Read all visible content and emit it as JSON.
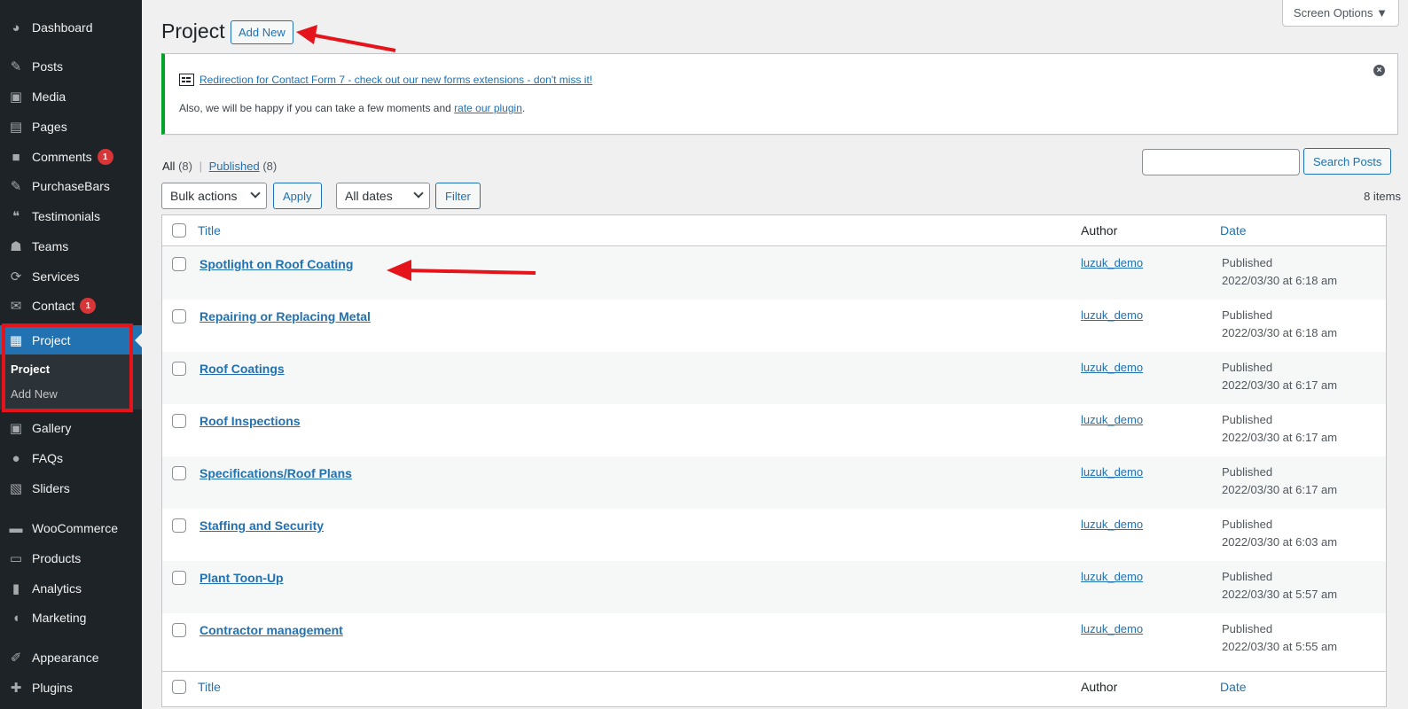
{
  "sidebar": {
    "items": [
      {
        "label": "Dashboard",
        "icon": "dashboard-icon",
        "glyph": "◕"
      },
      {
        "label": "Posts",
        "icon": "pin-icon",
        "glyph": "✎"
      },
      {
        "label": "Media",
        "icon": "media-icon",
        "glyph": "▣"
      },
      {
        "label": "Pages",
        "icon": "pages-icon",
        "glyph": "▤"
      },
      {
        "label": "Comments",
        "icon": "comment-icon",
        "glyph": "■",
        "badge": "1"
      },
      {
        "label": "PurchaseBars",
        "icon": "pin-icon",
        "glyph": "✎"
      },
      {
        "label": "Testimonials",
        "icon": "testimonial-icon",
        "glyph": "❝"
      },
      {
        "label": "Teams",
        "icon": "groups-icon",
        "glyph": "☗"
      },
      {
        "label": "Services",
        "icon": "services-icon",
        "glyph": "⟳"
      },
      {
        "label": "Contact",
        "icon": "mail-icon",
        "glyph": "✉",
        "badge": "1"
      },
      {
        "label": "Project",
        "icon": "portfolio-icon",
        "glyph": "▦"
      },
      {
        "label": "Gallery",
        "icon": "gallery-icon",
        "glyph": "▣"
      },
      {
        "label": "FAQs",
        "icon": "faq-icon",
        "glyph": "●"
      },
      {
        "label": "Sliders",
        "icon": "sliders-icon",
        "glyph": "▧"
      },
      {
        "label": "WooCommerce",
        "icon": "woocommerce-icon",
        "glyph": "▬"
      },
      {
        "label": "Products",
        "icon": "products-icon",
        "glyph": "▭"
      },
      {
        "label": "Analytics",
        "icon": "analytics-icon",
        "glyph": "▮"
      },
      {
        "label": "Marketing",
        "icon": "marketing-icon",
        "glyph": "◖"
      },
      {
        "label": "Appearance",
        "icon": "appearance-icon",
        "glyph": "✐"
      },
      {
        "label": "Plugins",
        "icon": "plugins-icon",
        "glyph": "✚"
      }
    ],
    "submenu": {
      "current": "Project",
      "add_new": "Add New"
    }
  },
  "header": {
    "title": "Project",
    "add_new": "Add New",
    "screen_options": "Screen Options ▼"
  },
  "notice": {
    "link_text": "Redirection for Contact Form 7 - check out our new forms extensions - don't miss it!",
    "line2_prefix": "Also, we will be happy if you can take a few moments and ",
    "line2_link": "rate our plugin",
    "line2_suffix": "."
  },
  "filters": {
    "all_label": "All",
    "all_count": "(8)",
    "separator": "|",
    "published_label": "Published",
    "published_count": "(8)",
    "bulk_actions": "Bulk actions",
    "apply": "Apply",
    "all_dates": "All dates",
    "filter": "Filter",
    "search_button": "Search Posts",
    "items_count": "8 items"
  },
  "table": {
    "columns": {
      "title": "Title",
      "author": "Author",
      "date": "Date"
    },
    "rows": [
      {
        "title": "Spotlight on Roof Coating",
        "author": "luzuk_demo",
        "status": "Published",
        "date": "2022/03/30 at 6:18 am"
      },
      {
        "title": "Repairing or Replacing Metal",
        "author": "luzuk_demo",
        "status": "Published",
        "date": "2022/03/30 at 6:18 am"
      },
      {
        "title": "Roof Coatings",
        "author": "luzuk_demo",
        "status": "Published",
        "date": "2022/03/30 at 6:17 am"
      },
      {
        "title": "Roof Inspections",
        "author": "luzuk_demo",
        "status": "Published",
        "date": "2022/03/30 at 6:17 am"
      },
      {
        "title": "Specifications/Roof Plans",
        "author": "luzuk_demo",
        "status": "Published",
        "date": "2022/03/30 at 6:17 am"
      },
      {
        "title": "Staffing and Security",
        "author": "luzuk_demo",
        "status": "Published",
        "date": "2022/03/30 at 6:03 am"
      },
      {
        "title": "Plant Toon-Up",
        "author": "luzuk_demo",
        "status": "Published",
        "date": "2022/03/30 at 5:57 am"
      },
      {
        "title": "Contractor management",
        "author": "luzuk_demo",
        "status": "Published",
        "date": "2022/03/30 at 5:55 am"
      }
    ]
  },
  "colors": {
    "accent": "#2271b1",
    "sidebar_bg": "#1d2327",
    "annotation_red": "#e5141b",
    "notice_green": "#00a32a"
  }
}
